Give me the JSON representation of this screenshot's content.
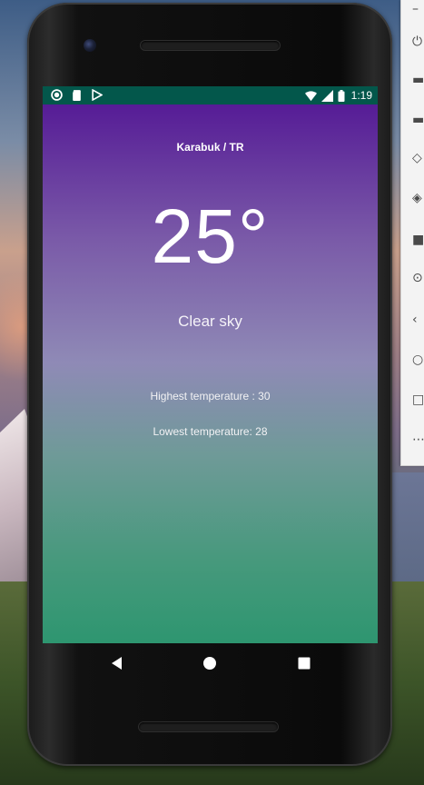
{
  "status_bar": {
    "time": "1:19",
    "left_icons": [
      "circle-notification-icon",
      "sd-card-icon",
      "play-store-icon"
    ],
    "right_icons": [
      "wifi-icon",
      "signal-icon",
      "battery-icon"
    ]
  },
  "weather": {
    "location": "Karabuk / TR",
    "temperature": "25°",
    "condition": "Clear sky",
    "highest_label": "Highest temperature :  30",
    "lowest_label": "Lowest temperature:  28"
  },
  "nav_bar": {
    "buttons": [
      "back-icon",
      "home-icon",
      "recents-icon"
    ]
  },
  "emulator_toolbar": {
    "icons": [
      "power-icon",
      "volume-up-icon",
      "volume-down-icon",
      "rotate-left-icon",
      "rotate-right-icon",
      "camera-icon",
      "zoom-icon",
      "back-icon",
      "home-icon",
      "overview-icon",
      "more-icon"
    ]
  },
  "colors": {
    "status_bar": "#03574b",
    "gradient_top": "#561c96",
    "gradient_mid": "#8f8ab6",
    "gradient_bottom": "#2e9670"
  }
}
